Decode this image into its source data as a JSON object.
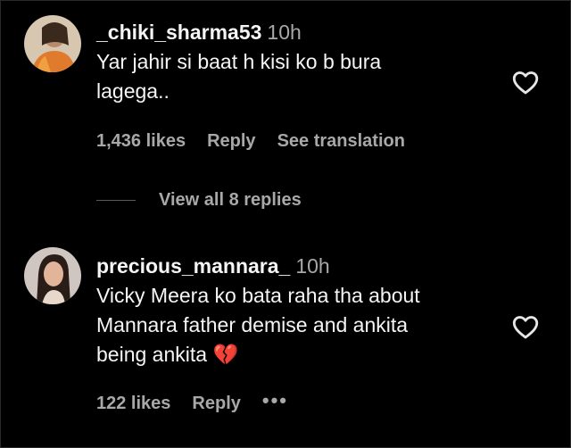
{
  "comments": [
    {
      "username": "_chiki_sharma53",
      "time": "10h",
      "text_lines": [
        "Yar jahir si baat h kisi ko b bura",
        "lagega.."
      ],
      "likes": "1,436 likes",
      "reply_label": "Reply",
      "translate_label": "See translation",
      "avatar_icon": "profile-photo"
    },
    {
      "username": "precious_mannara_",
      "time": "10h",
      "text_lines": [
        "Vicky Meera ko bata raha tha about",
        "Mannara father demise and ankita",
        "being ankita"
      ],
      "emoji": "💔",
      "likes": "122 likes",
      "reply_label": "Reply",
      "more_label": "•••",
      "avatar_icon": "profile-photo"
    }
  ],
  "view_replies_label": "View all 8 replies",
  "icons": {
    "like": "heart-outline-icon",
    "more": "more-options-icon",
    "emoji": "broken-heart-icon"
  },
  "colors": {
    "background": "#000000",
    "primary_text": "#f5f5f5",
    "secondary_text": "#a8a8a8",
    "emoji": "#e8577a"
  }
}
